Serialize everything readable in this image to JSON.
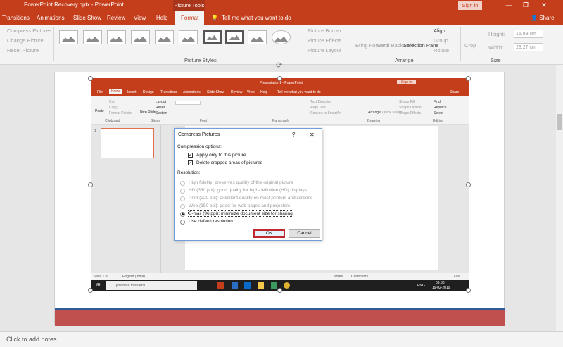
{
  "titlebar": {
    "title": "PowerPoint Recovery.pptx  -  PowerPoint",
    "context_tab": "Picture Tools",
    "signin": "Sign in",
    "window_buttons": [
      "—",
      "❐",
      "✕"
    ]
  },
  "tabs": {
    "items": [
      "Transitions",
      "Animations",
      "Slide Show",
      "Review",
      "View",
      "Help"
    ],
    "active": "Format",
    "tellme": "Tell me what you want to do",
    "share": "Share"
  },
  "ribbon": {
    "adjust": [
      "Compress Pictures",
      "Change Picture",
      "Reset Picture"
    ],
    "styles_label": "Picture Styles",
    "style_options": [
      "Picture Border",
      "Picture Effects",
      "Picture Layout"
    ],
    "arrange_items": [
      "Bring Forward",
      "Send Backward",
      "Selection Pane"
    ],
    "align_items": [
      "Align",
      "Group",
      "Rotate"
    ],
    "arrange_label": "Arrange",
    "crop": "Crop",
    "height_label": "Height:",
    "height_value": "15.89 cm",
    "width_label": "Width:",
    "width_value": "28.27 cm",
    "size_label": "Size"
  },
  "inner": {
    "title": "Presentation1 - PowerPoint",
    "signin": "Sign in",
    "tabs": [
      "File",
      "Home",
      "Insert",
      "Design",
      "Transitions",
      "Animations",
      "Slide Show",
      "Review",
      "View",
      "Help"
    ],
    "tellme": "Tell me what you want to do",
    "share": "Share",
    "groups": [
      "Clipboard",
      "Slides",
      "Font",
      "Paragraph",
      "Drawing",
      "Editing"
    ],
    "clipboard": [
      "Paste",
      "Cut",
      "Copy",
      "Format Painter"
    ],
    "slides": [
      "New Slide",
      "Layout",
      "Reset",
      "Section"
    ],
    "paragraph_opts": [
      "Text Direction",
      "Align Text",
      "Convert to SmartArt"
    ],
    "drawing": [
      "Arrange",
      "Quick Styles",
      "Shape Fill",
      "Shape Outline",
      "Shape Effects"
    ],
    "editing": [
      "Find",
      "Replace",
      "Select"
    ],
    "slide_num": "1",
    "status_left": "Slide 1 of 1",
    "status_lang": "English (India)",
    "status_notes": "Notes",
    "status_comments": "Comments",
    "zoom": "72%",
    "taskbar_search": "Type here to search",
    "lang": "ENG",
    "time": "09:30",
    "date": "19-02-2019"
  },
  "dialog": {
    "title": "Compress Pictures",
    "help": "?",
    "close": "✕",
    "compression_header": "Compression options:",
    "opt_apply": "Apply only to this picture",
    "opt_delete": "Delete cropped areas of pictures",
    "resolution_header": "Resolution:",
    "resolutions": [
      "High fidelity: preserves quality of the original picture",
      "HD (330 ppi): good quality for high-definition (HD) displays",
      "Print (220 ppi): excellent quality on most printers and screens",
      "Web (150 ppi): good for web pages and projectors",
      "E-mail (96 ppi): minimize document size for sharing",
      "Use default resolution"
    ],
    "ok": "OK",
    "cancel": "Cancel"
  },
  "notes": {
    "placeholder": "Click to add notes"
  },
  "colors": {
    "accent": "#c43e1c",
    "slide_band": "#c0504d",
    "slide_line": "#2f5b9a"
  }
}
